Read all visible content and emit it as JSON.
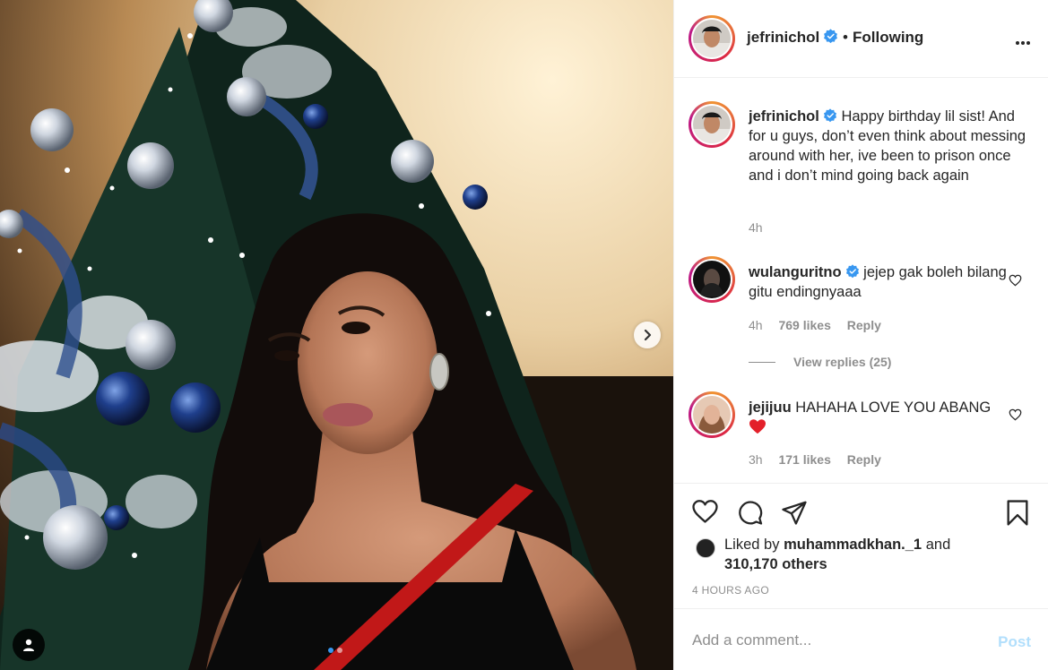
{
  "post": {
    "author": "jefrinichol",
    "follow_status": "Following",
    "separator": "•",
    "more_label": "•••",
    "media": {
      "current_slide": 1,
      "total_slides": 2
    }
  },
  "caption": {
    "username": "jefrinichol",
    "text": "Happy birthday lil sist! And for u guys, don’t even think about messing around with her, ive been to prison once and i don’t mind going back again",
    "time": "4h"
  },
  "comments": [
    {
      "username": "wulanguritno",
      "verified": true,
      "text": "jejep gak boleh bilang gitu endingnyaaa",
      "time": "4h",
      "likes": "769 likes",
      "reply_label": "Reply",
      "view_replies": "View replies (25)"
    },
    {
      "username": "jejijuu",
      "verified": false,
      "text": "HAHAHA LOVE YOU ABANG",
      "time": "3h",
      "likes": "171 likes",
      "reply_label": "Reply"
    }
  ],
  "liked_by": {
    "prefix": "Liked by",
    "user": "muhammadkhan._1",
    "and": "and",
    "others": "310,170 others"
  },
  "timestamp": "4 HOURS AGO",
  "add_comment": {
    "placeholder": "Add a comment...",
    "post_label": "Post"
  },
  "colors": {
    "verified": "#3897f0",
    "post_disabled": "#b2dffc",
    "muted": "#8e8e8e",
    "story_ring_start": "#f09433",
    "story_ring_end": "#bc1888"
  },
  "icons": [
    "chevron-right-icon",
    "user-tag-icon",
    "heart-icon",
    "comment-icon",
    "share-icon",
    "bookmark-icon",
    "verified-icon",
    "more-icon",
    "red-heart-emoji"
  ]
}
